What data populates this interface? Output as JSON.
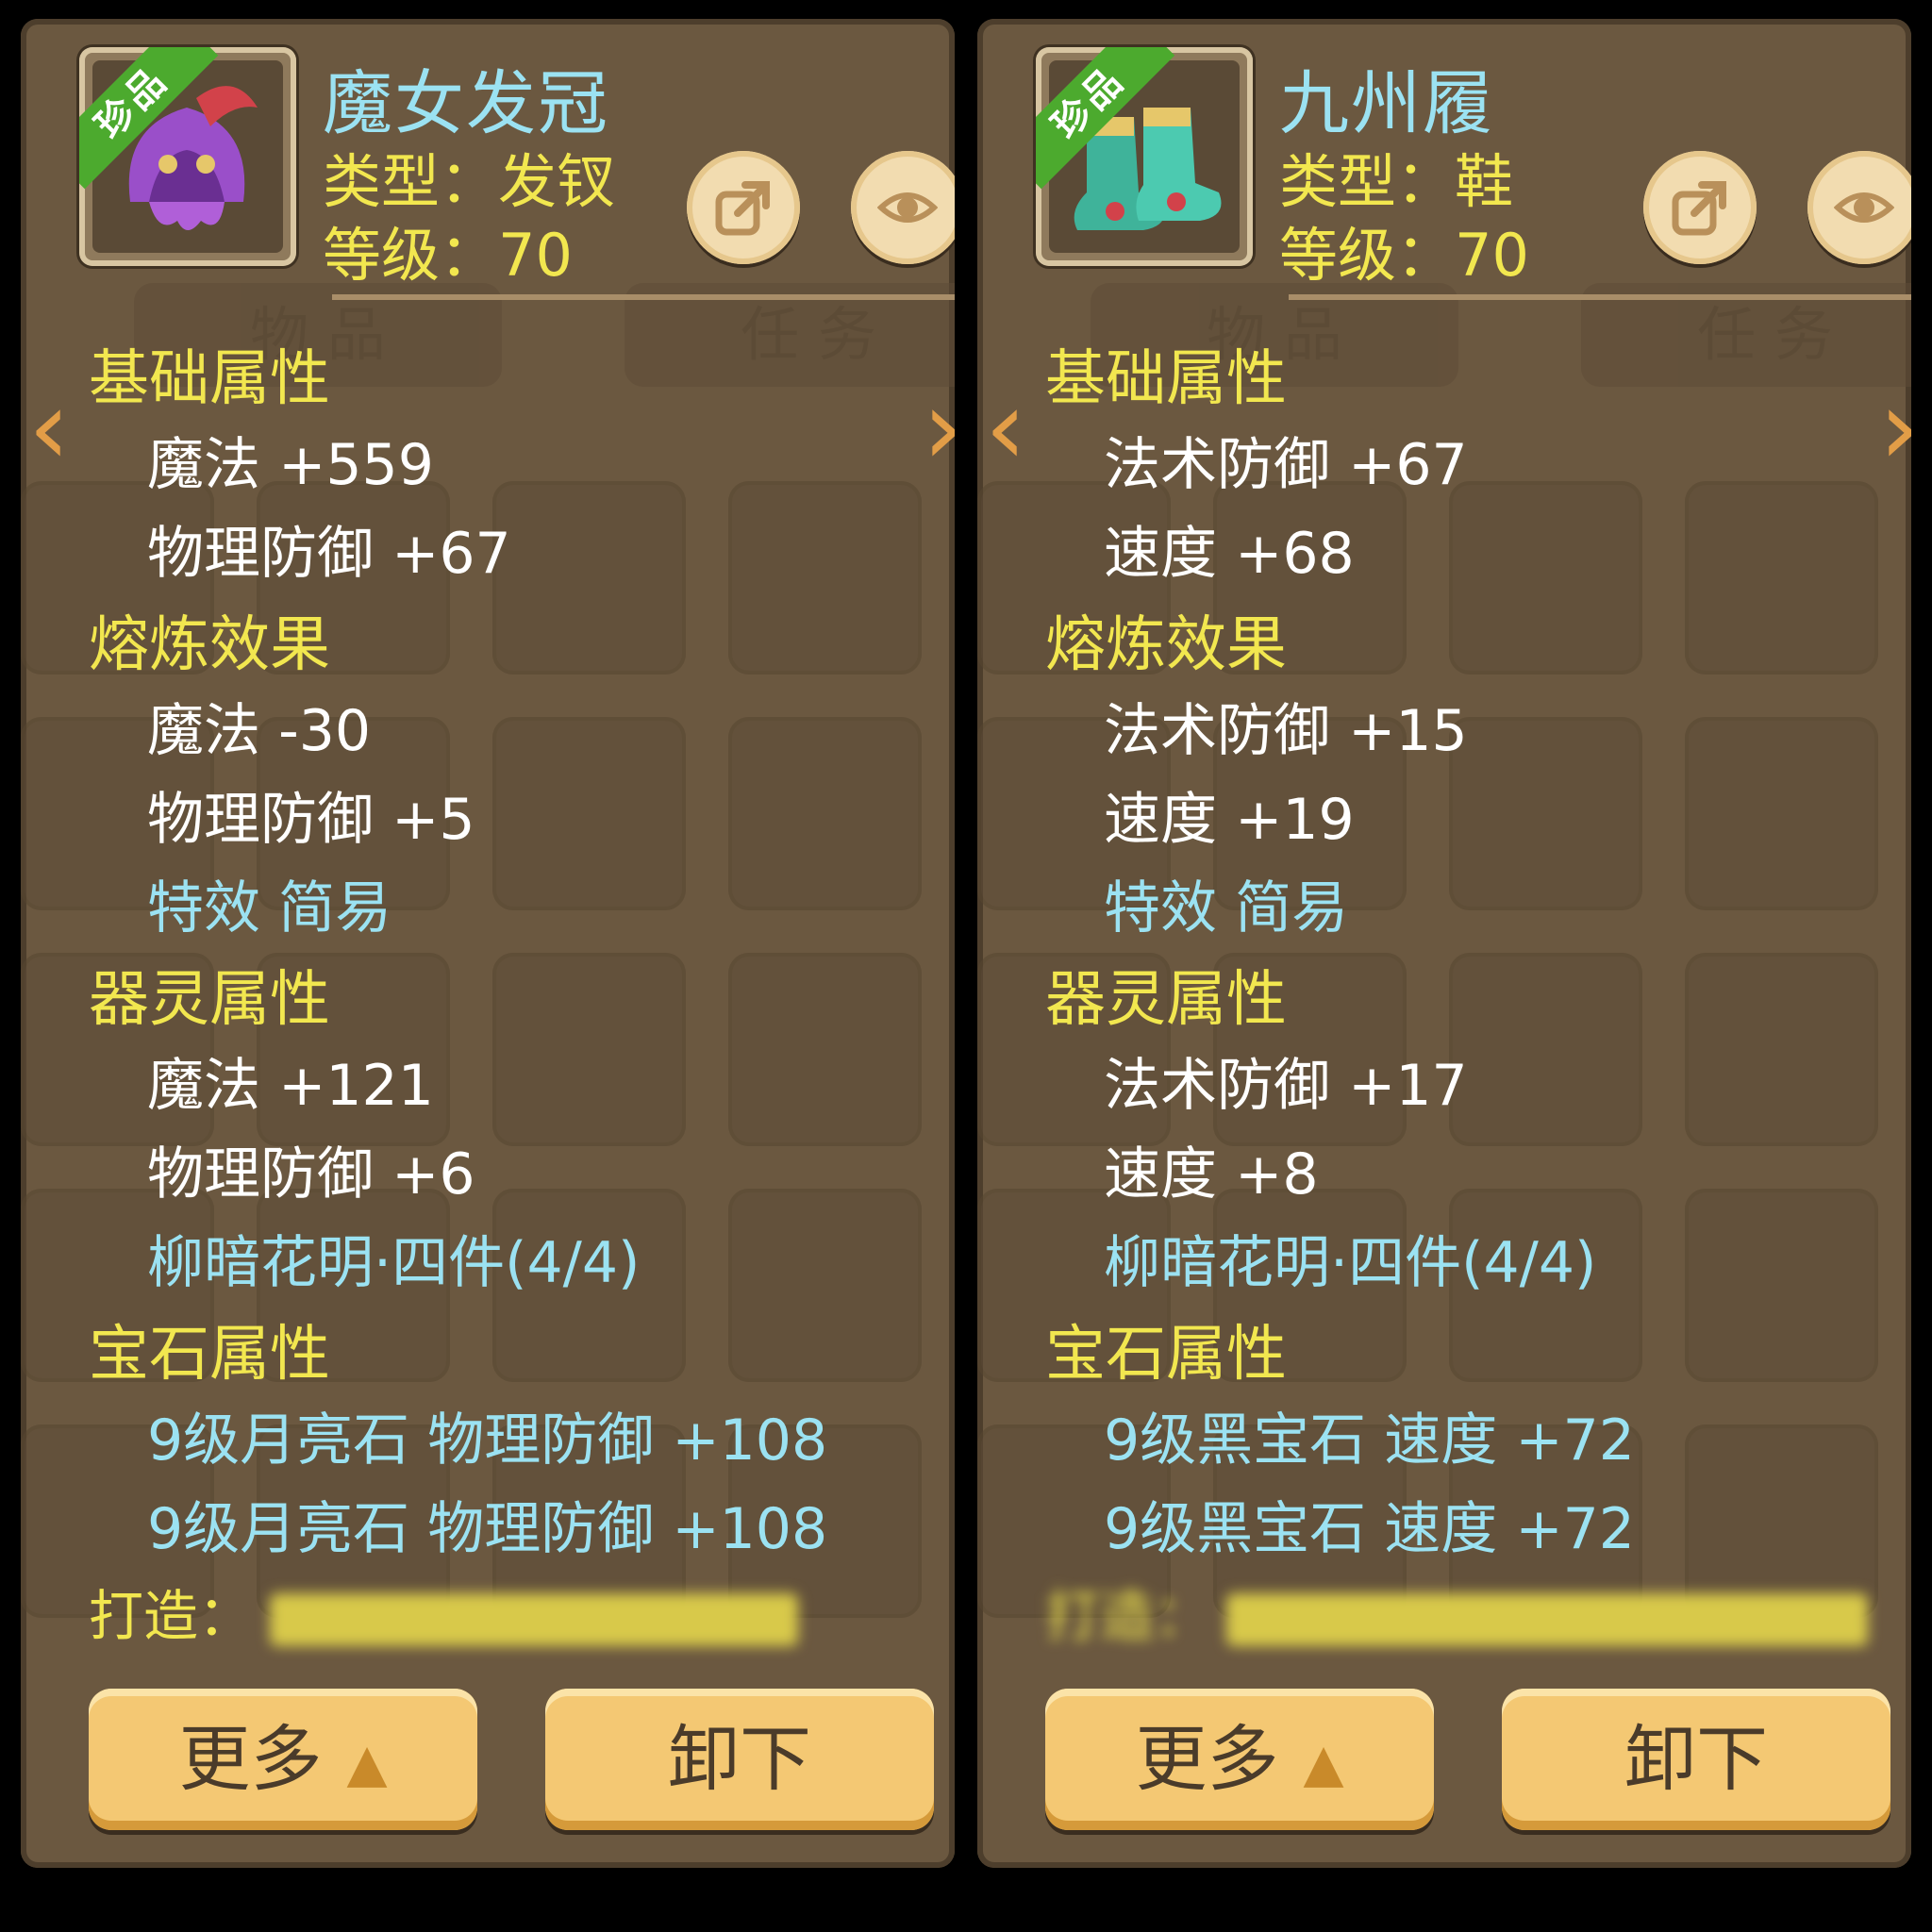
{
  "left": {
    "item_name": "魔女发冠",
    "rarity_badge": "珍品",
    "type_line": "类型：发钗",
    "level_line": "等级：70",
    "bg_tabs": [
      "物 品",
      "任 务"
    ],
    "sections": {
      "base": {
        "title": "基础属性",
        "stats": [
          "魔法  +559",
          "物理防御  +67"
        ]
      },
      "smelt": {
        "title": "熔炼效果",
        "stats": [
          "魔法  -30",
          "物理防御  +5"
        ],
        "special": "特效  简易"
      },
      "spirit": {
        "title": "器灵属性",
        "stats": [
          "魔法  +121",
          "物理防御  +6"
        ],
        "set": "柳暗花明·四件(4/4)"
      },
      "gem": {
        "title": "宝石属性",
        "gems": [
          "9级月亮石  物理防御  +108",
          "9级月亮石  物理防御  +108"
        ]
      }
    },
    "maker": "打造：",
    "buttons": {
      "more": "更多",
      "unequip": "卸下"
    }
  },
  "right": {
    "item_name": "九州履",
    "rarity_badge": "珍品",
    "type_line": "类型：鞋",
    "level_line": "等级：70",
    "bg_tabs": [
      "物 品",
      "任 务"
    ],
    "sections": {
      "base": {
        "title": "基础属性",
        "stats": [
          "法术防御  +67",
          "速度  +68"
        ]
      },
      "smelt": {
        "title": "熔炼效果",
        "stats": [
          "法术防御  +15",
          "速度  +19"
        ],
        "special": "特效  简易"
      },
      "spirit": {
        "title": "器灵属性",
        "stats": [
          "法术防御  +17",
          "速度  +8"
        ],
        "set": "柳暗花明·四件(4/4)"
      },
      "gem": {
        "title": "宝石属性",
        "gems": [
          "9级黑宝石  速度  +72",
          "9级黑宝石  速度  +72"
        ]
      }
    },
    "maker": "打造：",
    "buttons": {
      "more": "更多",
      "unequip": "卸下"
    }
  },
  "colors": {
    "panel_bg": "#6b5840",
    "section_title": "#f2e74f",
    "stat_text": "#ffffff",
    "special_text": "#9be2f2",
    "button_bg": "#f4c873",
    "rarity_green": "#4caa2e"
  },
  "icons": [
    "share-icon",
    "eye-icon",
    "chevron-left-icon",
    "chevron-right-icon",
    "caret-up-icon"
  ]
}
